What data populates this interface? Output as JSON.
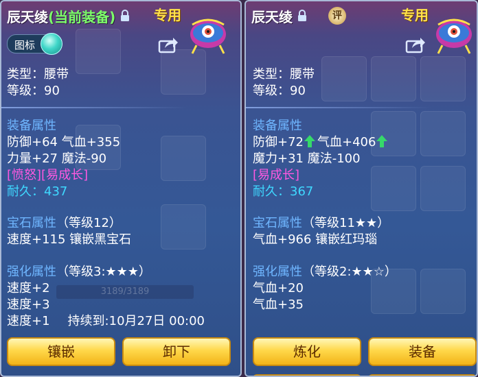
{
  "left_panel": {
    "title": "辰天绫",
    "title_status": "(当前装备)",
    "exclusive": "专用",
    "toggle_label": "图标",
    "type_row": "类型：腰带",
    "level_row": "等级：90",
    "attr_header": "装备属性",
    "attr_row1": "防御+64 气血+355",
    "attr_row2": "力量+27 魔法-90",
    "special": "[愤怒][易成长]",
    "durability_label": "耐久：",
    "durability_value": "437",
    "gem_header": "宝石属性",
    "gem_level": "（等级12）",
    "gem_row": "速度+115 镶嵌黑宝石",
    "enhance_header": "强化属性",
    "enhance_level": "（等级3:★★★）",
    "enhance_rows": [
      "速度+2",
      "速度+3",
      "速度+1"
    ],
    "duration": "持续到:10月27日 00:00",
    "bg_bar_text": "3189/3189",
    "button_inlay": "镶嵌",
    "button_unequip": "卸下"
  },
  "right_panel": {
    "title": "辰天绫",
    "rate_badge": "评",
    "exclusive": "专用",
    "type_row": "类型：腰带",
    "level_row": "等级：90",
    "attr_header": "装备属性",
    "attr_def": "防御+72",
    "attr_hp": "气血+406",
    "attr_row2": "魔力+31 魔法-100",
    "special": "[易成长]",
    "durability_label": "耐久：",
    "durability_value": "367",
    "gem_header": "宝石属性",
    "gem_level": "（等级11★★）",
    "gem_row": "气血+966 镶嵌红玛瑙",
    "enhance_header": "强化属性",
    "enhance_level": "（等级2:★★☆）",
    "enhance_rows": [
      "气血+20",
      "气血+35"
    ],
    "button_refine": "炼化",
    "button_equip": "装备"
  },
  "colors": {
    "title_status": "#7dff6a",
    "exclusive": "#ffe14a",
    "section_header": "#6fb6ff",
    "special_tag": "#ff58e0",
    "durability": "#3fd8ff",
    "arrow_up": "#36d86a",
    "button": "#ffd84a"
  },
  "icons": [
    "lock-icon",
    "share-icon",
    "avatar-icon",
    "arrow-up-icon",
    "rating-icon"
  ]
}
